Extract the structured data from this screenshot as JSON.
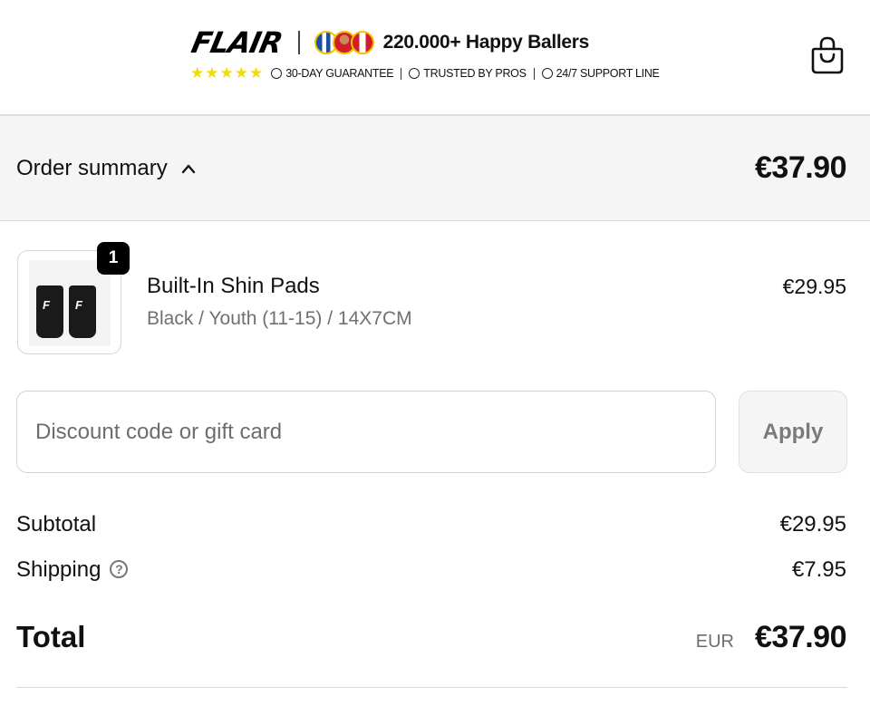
{
  "header": {
    "logo_text": "FLAIR",
    "happy_ballers": "220.000+ Happy Ballers",
    "stars": "★★★★★",
    "badges": [
      "30-DAY GUARANTEE",
      "TRUSTED BY PROS",
      "24/7 SUPPORT LINE"
    ],
    "cart_icon": "shopping-bag-icon",
    "star_color": "#f5d90a"
  },
  "summary": {
    "toggle_label": "Order summary",
    "toggle_icon": "chevron-up-icon",
    "total": "€37.90"
  },
  "item": {
    "quantity": "1",
    "name": "Built-In Shin Pads",
    "variant": "Black / Youth (11-15) / 14X7CM",
    "price": "€29.95",
    "thumb_logo": "F"
  },
  "discount": {
    "placeholder": "Discount code or gift card",
    "apply_label": "Apply"
  },
  "totals": {
    "subtotal_label": "Subtotal",
    "subtotal_value": "€29.95",
    "shipping_label": "Shipping",
    "shipping_help": "?",
    "shipping_value": "€7.95",
    "total_label": "Total",
    "currency": "EUR",
    "total_value": "€37.90"
  }
}
